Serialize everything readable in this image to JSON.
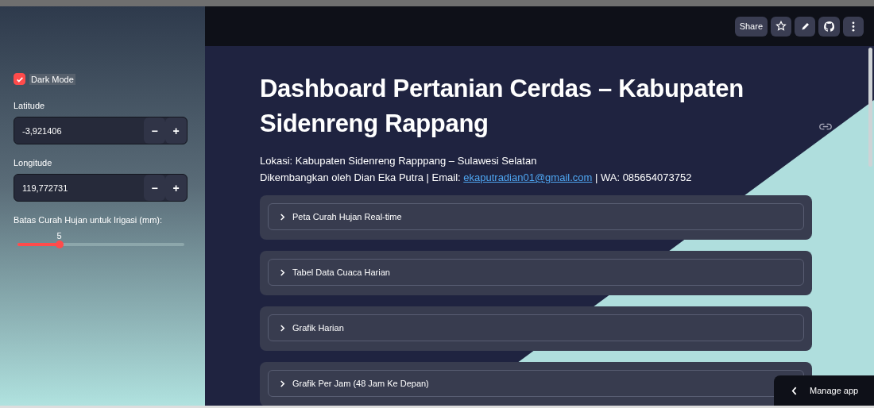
{
  "sidebar": {
    "dark_mode": {
      "label": "Dark Mode",
      "checked": true
    },
    "inputs": [
      {
        "label": "Latitude",
        "value": "-3,921406",
        "minus": "−",
        "plus": "+"
      },
      {
        "label": "Longitude",
        "value": "119,772731",
        "minus": "−",
        "plus": "+"
      }
    ],
    "slider": {
      "label": "Batas Curah Hujan untuk Irigasi (mm):",
      "reading": "5",
      "level": 0.25
    }
  },
  "toolbar": {
    "share": "Share"
  },
  "main": {
    "title": "Dashboard Pertanian Cerdas – Kabupaten Sidenreng Rappang",
    "location": "Lokasi: Kabupaten Sidenreng Rapppang – Sulawesi Selatan",
    "credit_before": "Dikembangkan oleh Dian Eka Putra | Email: ",
    "email": "ekaputradian01@gmail.com",
    "credit_after": " | WA: 085654073752",
    "expanders": [
      {
        "label": "Peta Curah Hujan Real-time",
        "expanded": false
      },
      {
        "label": "Tabel Data Cuaca Harian",
        "expanded": false
      },
      {
        "label": "Grafik Harian",
        "expanded": false
      },
      {
        "label": "Grafik Per Jam (48 Jam Ke Depan)",
        "expanded": false
      }
    ]
  },
  "manage_app": {
    "label": "Manage app"
  }
}
